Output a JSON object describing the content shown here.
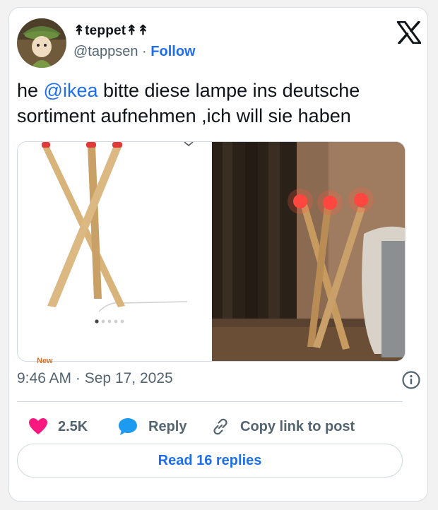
{
  "author": {
    "display_name": "↟teppet↟↟",
    "handle": "@tappsen",
    "separator": "·",
    "follow_label": "Follow"
  },
  "tweet": {
    "text_before": "he ",
    "mention": "@ikea",
    "text_after": "  bitte diese lampe ins deutsche sortiment aufnehmen ,ich will sie haben"
  },
  "media": {
    "badge": "New"
  },
  "meta": {
    "time": "9:46 AM",
    "separator": "·",
    "date": "Sep 17, 2025"
  },
  "actions": {
    "like_count": "2.5K",
    "reply_label": "Reply",
    "copy_label": "Copy link to post"
  },
  "read_replies_label": "Read 16 replies",
  "colors": {
    "link": "#1d6ff0",
    "like": "#f91880",
    "reply": "#1d9bf0",
    "muted": "#536471"
  }
}
